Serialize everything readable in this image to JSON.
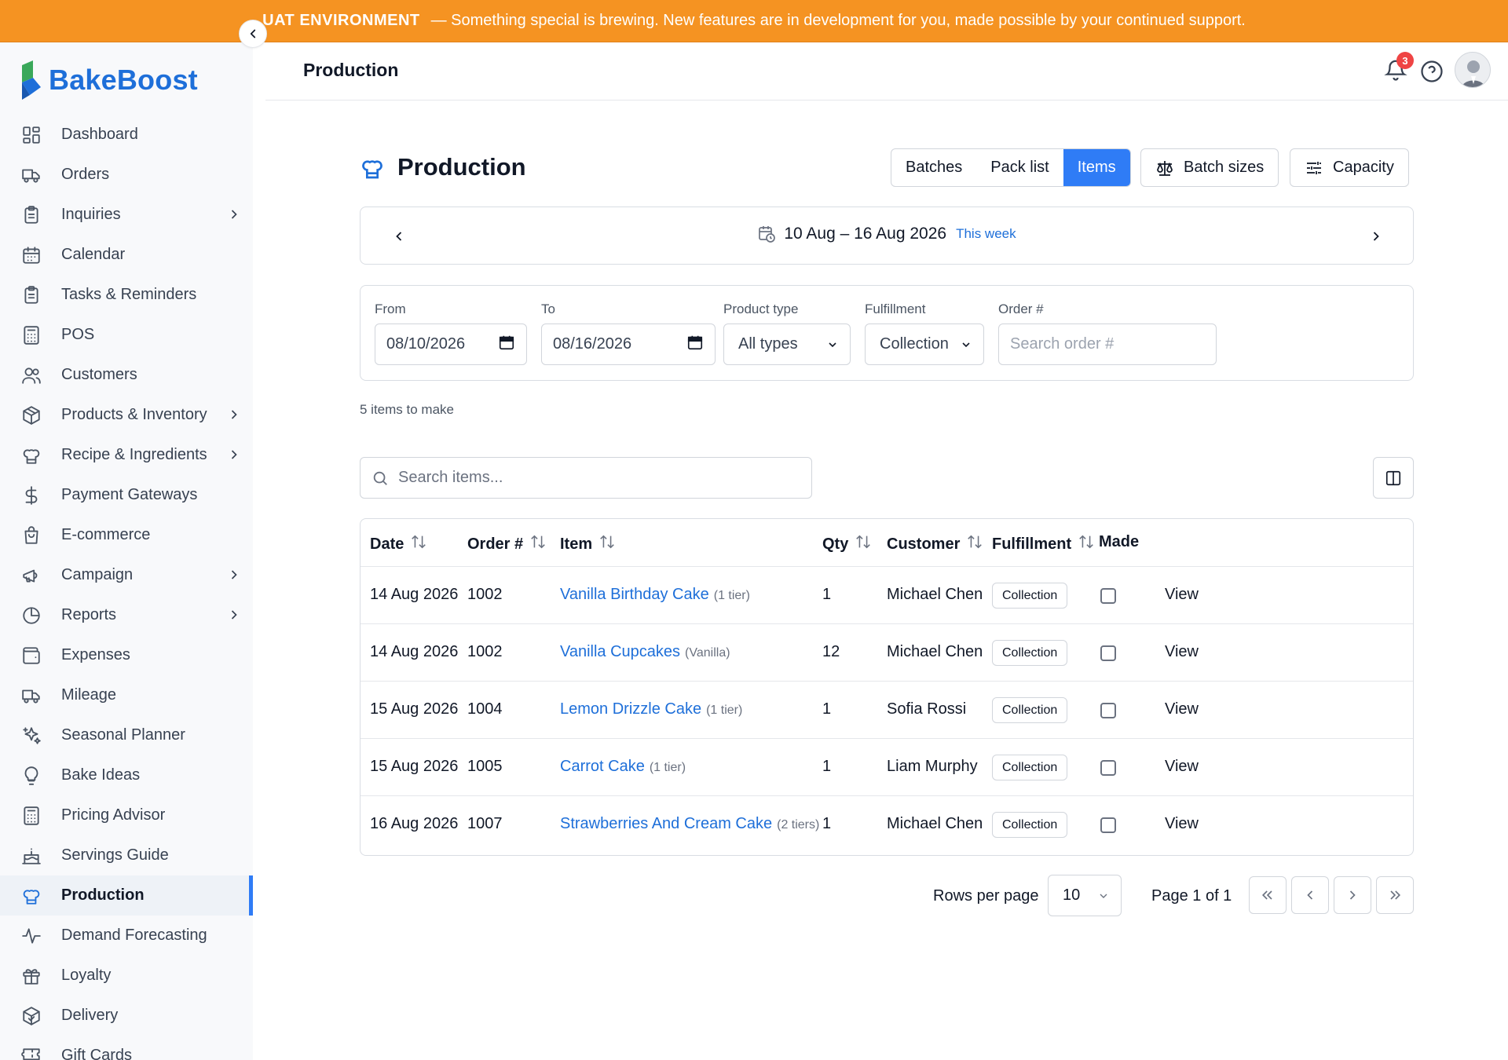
{
  "banner": {
    "env": "UAT ENVIRONMENT",
    "message": "— Something special is brewing. New features are in development for you, made possible by your continued support."
  },
  "brand": {
    "name": "BakeBoost",
    "color": "#1e6fd9"
  },
  "sidebar": {
    "items": [
      {
        "label": "Dashboard",
        "icon": "dashboard-icon",
        "chevron": false
      },
      {
        "label": "Orders",
        "icon": "truck-icon",
        "chevron": false
      },
      {
        "label": "Inquiries",
        "icon": "clipboard-icon",
        "chevron": true
      },
      {
        "label": "Calendar",
        "icon": "calendar-icon",
        "chevron": false
      },
      {
        "label": "Tasks & Reminders",
        "icon": "clipboard-icon",
        "chevron": false
      },
      {
        "label": "POS",
        "icon": "calculator-icon",
        "chevron": false
      },
      {
        "label": "Customers",
        "icon": "users-icon",
        "chevron": false
      },
      {
        "label": "Products & Inventory",
        "icon": "package-icon",
        "chevron": true
      },
      {
        "label": "Recipe & Ingredients",
        "icon": "chef-hat-icon",
        "chevron": true
      },
      {
        "label": "Payment Gateways",
        "icon": "dollar-icon",
        "chevron": false
      },
      {
        "label": "E-commerce",
        "icon": "shopping-bag-icon",
        "chevron": false
      },
      {
        "label": "Campaign",
        "icon": "megaphone-icon",
        "chevron": true
      },
      {
        "label": "Reports",
        "icon": "pie-chart-icon",
        "chevron": true
      },
      {
        "label": "Expenses",
        "icon": "wallet-icon",
        "chevron": false
      },
      {
        "label": "Mileage",
        "icon": "truck-icon",
        "chevron": false
      },
      {
        "label": "Seasonal Planner",
        "icon": "sparkles-icon",
        "chevron": false
      },
      {
        "label": "Bake Ideas",
        "icon": "lightbulb-icon",
        "chevron": false
      },
      {
        "label": "Pricing Advisor",
        "icon": "calculator-icon",
        "chevron": false
      },
      {
        "label": "Servings Guide",
        "icon": "cake-icon",
        "chevron": false
      },
      {
        "label": "Production",
        "icon": "chef-hat-icon",
        "chevron": false,
        "active": true
      },
      {
        "label": "Demand Forecasting",
        "icon": "activity-icon",
        "chevron": false
      },
      {
        "label": "Loyalty",
        "icon": "gift-icon",
        "chevron": false
      },
      {
        "label": "Delivery",
        "icon": "package-check-icon",
        "chevron": false
      },
      {
        "label": "Gift Cards",
        "icon": "ticket-icon",
        "chevron": false
      }
    ]
  },
  "header": {
    "title": "Production",
    "notification_count": "3"
  },
  "page": {
    "title": "Production",
    "tabs": [
      {
        "label": "Batches",
        "active": false
      },
      {
        "label": "Pack list",
        "active": false
      },
      {
        "label": "Items",
        "active": true
      }
    ],
    "batch_sizes_label": "Batch sizes",
    "capacity_label": "Capacity",
    "week_range": "10 Aug – 16 Aug 2026",
    "this_week": "This week",
    "filters": {
      "from_label": "From",
      "from_value": "08/10/2026",
      "to_label": "To",
      "to_value": "08/16/2026",
      "product_type_label": "Product type",
      "product_type_value": "All types",
      "fulfillment_label": "Fulfillment",
      "fulfillment_value": "Collection",
      "order_label": "Order #",
      "order_placeholder": "Search order #"
    },
    "count_text": "5 items to make",
    "search_placeholder": "Search items...",
    "columns": [
      "Date",
      "Order #",
      "Item",
      "Qty",
      "Customer",
      "Fulfillment",
      "Made"
    ],
    "rows": [
      {
        "date": "14 Aug 2026",
        "order": "1002",
        "item": "Vanilla Birthday Cake",
        "variant": "(1 tier)",
        "qty": "1",
        "customer": "Michael Chen",
        "fulfillment": "Collection",
        "action": "View"
      },
      {
        "date": "14 Aug 2026",
        "order": "1002",
        "item": "Vanilla Cupcakes",
        "variant": "(Vanilla)",
        "qty": "12",
        "customer": "Michael Chen",
        "fulfillment": "Collection",
        "action": "View"
      },
      {
        "date": "15 Aug 2026",
        "order": "1004",
        "item": "Lemon Drizzle Cake",
        "variant": "(1 tier)",
        "qty": "1",
        "customer": "Sofia Rossi",
        "fulfillment": "Collection",
        "action": "View"
      },
      {
        "date": "15 Aug 2026",
        "order": "1005",
        "item": "Carrot Cake",
        "variant": "(1 tier)",
        "qty": "1",
        "customer": "Liam Murphy",
        "fulfillment": "Collection",
        "action": "View"
      },
      {
        "date": "16 Aug 2026",
        "order": "1007",
        "item": "Strawberries And Cream Cake",
        "variant": "(2 tiers)",
        "qty": "1",
        "customer": "Michael Chen",
        "fulfillment": "Collection",
        "action": "View"
      }
    ],
    "pagination": {
      "rows_per_page_label": "Rows per page",
      "rows_per_page_value": "10",
      "page_text": "Page 1 of 1"
    }
  },
  "colors": {
    "banner": "#f59322",
    "accent": "#2f7cf6",
    "link": "#1e6fd9"
  }
}
